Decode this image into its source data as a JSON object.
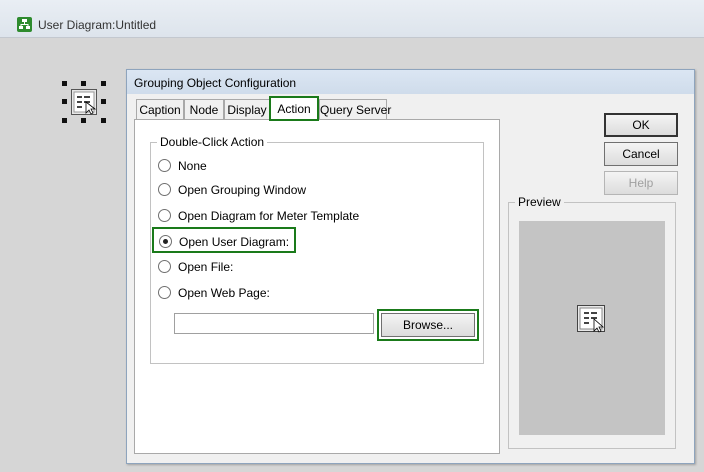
{
  "window": {
    "title": "User Diagram:Untitled",
    "icon": "diagram-icon"
  },
  "dialog": {
    "title": "Grouping Object Configuration",
    "tabs": [
      {
        "label": "Caption",
        "active": false
      },
      {
        "label": "Node",
        "active": false
      },
      {
        "label": "Display",
        "active": false
      },
      {
        "label": "Action",
        "active": true
      },
      {
        "label": "Query Server",
        "active": false
      }
    ],
    "double_click_action": {
      "label": "Double-Click Action",
      "options": [
        {
          "label": "None",
          "selected": false
        },
        {
          "label": "Open Grouping Window",
          "selected": false
        },
        {
          "label": "Open Diagram for Meter Template",
          "selected": false
        },
        {
          "label": "Open User Diagram:",
          "selected": true
        },
        {
          "label": "Open File:",
          "selected": false
        },
        {
          "label": "Open Web Page:",
          "selected": false
        }
      ],
      "path_value": "",
      "browse_label": "Browse..."
    },
    "buttons": {
      "ok": "OK",
      "cancel": "Cancel",
      "help": "Help"
    },
    "preview": {
      "label": "Preview",
      "icon": "grouping-object-icon"
    },
    "colors": {
      "highlight": "#1a7a1a",
      "dialog_border": "#8ea4bd"
    }
  }
}
